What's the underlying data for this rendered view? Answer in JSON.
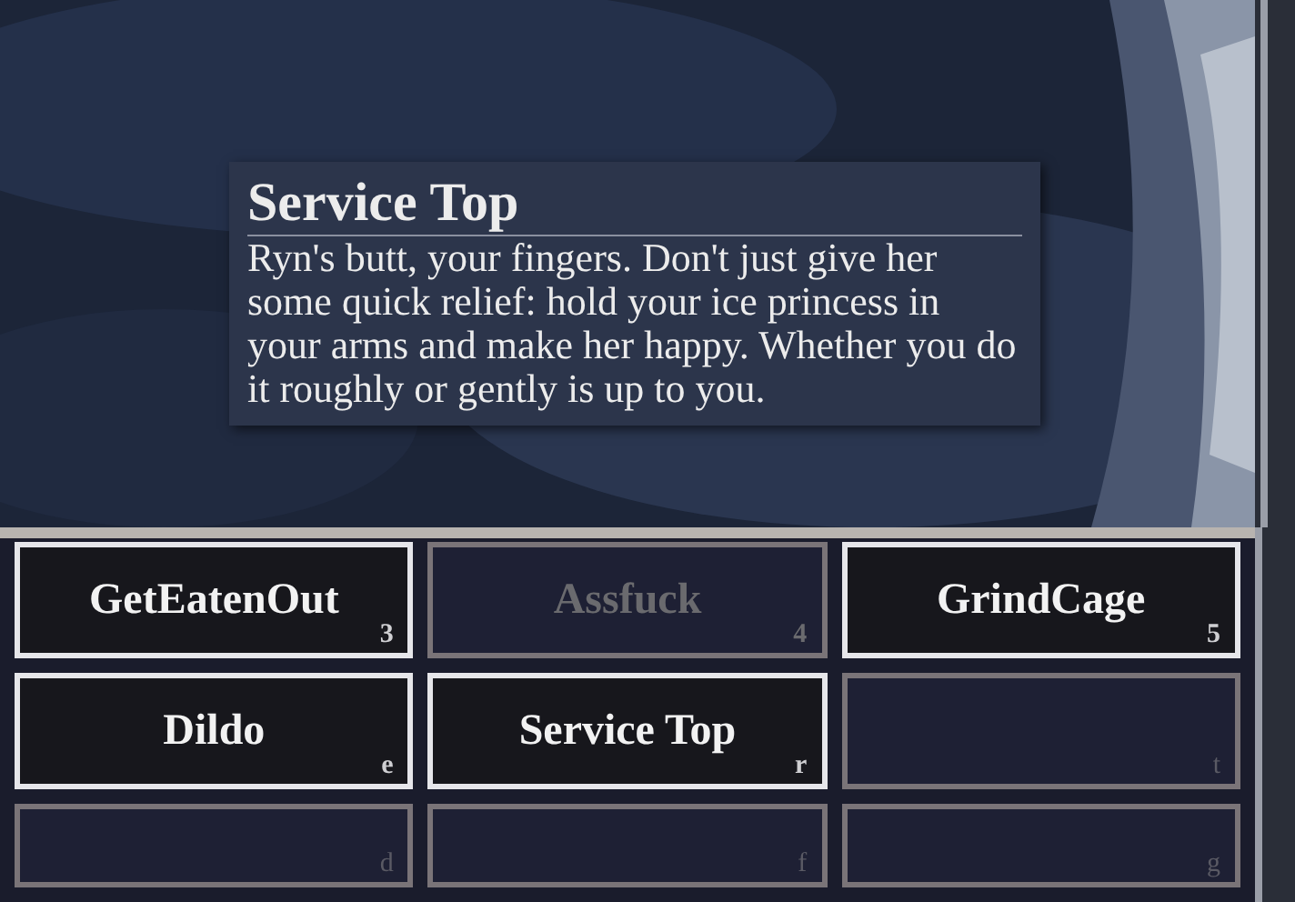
{
  "tooltip": {
    "title": "Service Top",
    "text": "Ryn's butt, your fingers. Don't just give her some quick relief: hold your ice princess in your arms and make her happy. Whether you do it roughly or gently is up to you."
  },
  "buttons": [
    {
      "kind": "action",
      "label": "GetEatenOut",
      "key": "3",
      "disabled": false
    },
    {
      "kind": "action",
      "label": "Assfuck",
      "key": "4",
      "disabled": true
    },
    {
      "kind": "action",
      "label": "GrindCage",
      "key": "5",
      "disabled": false
    },
    {
      "kind": "action",
      "label": "Dildo",
      "key": "e",
      "disabled": false
    },
    {
      "kind": "action",
      "label": "Service Top",
      "key": "r",
      "disabled": false
    },
    {
      "kind": "empty",
      "key": "t"
    },
    {
      "kind": "empty",
      "key": "d"
    },
    {
      "kind": "empty",
      "key": "f"
    },
    {
      "kind": "empty",
      "key": "g"
    }
  ]
}
